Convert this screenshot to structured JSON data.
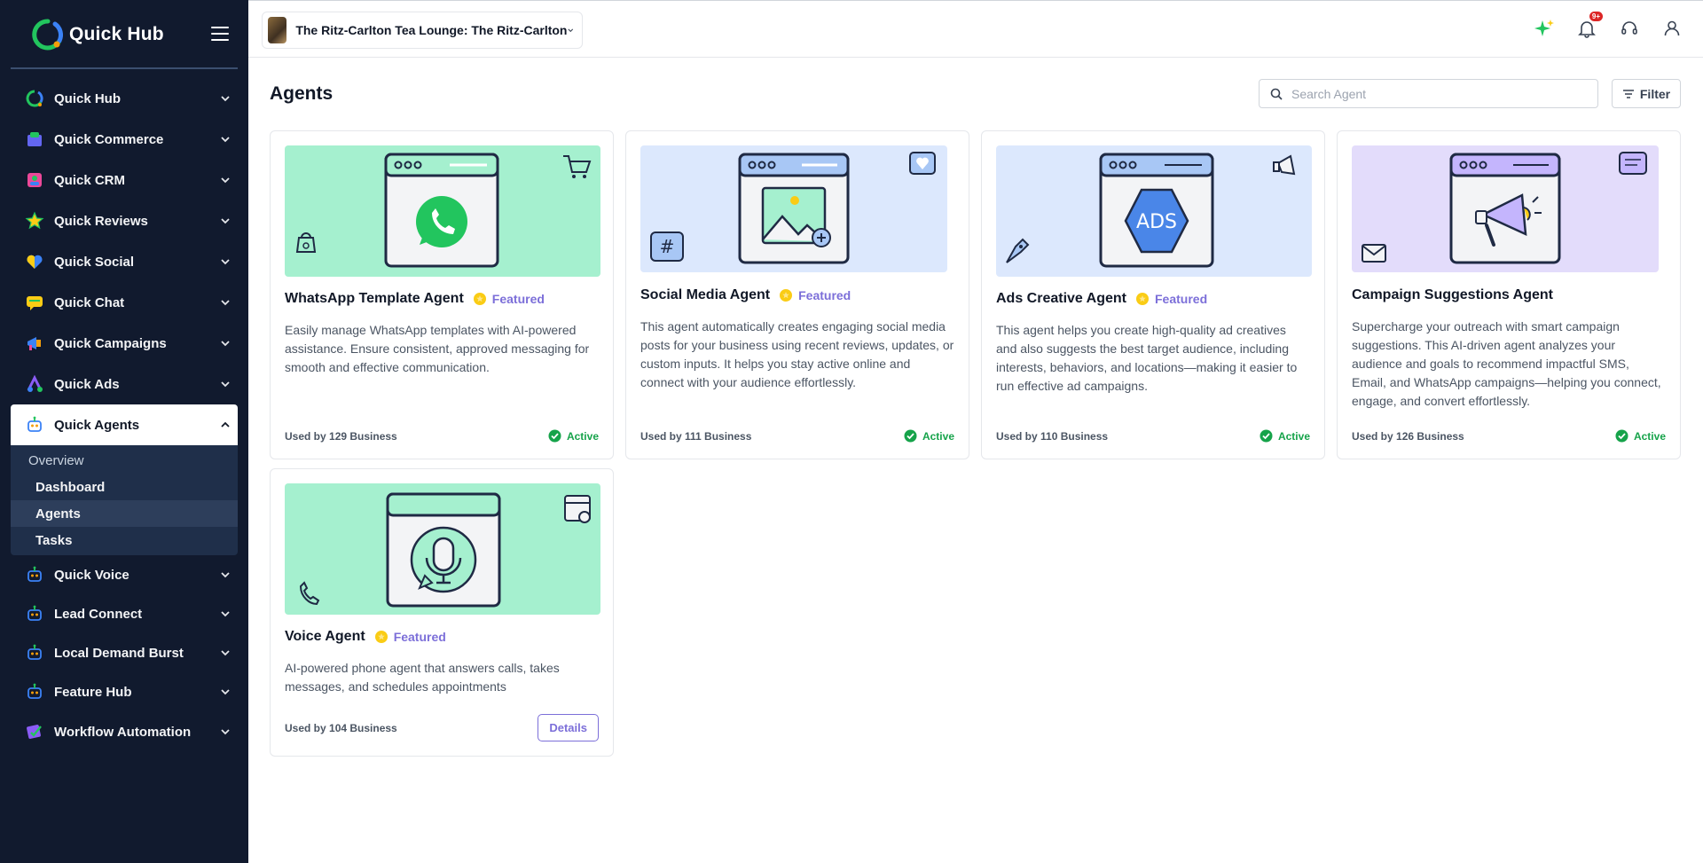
{
  "brand": {
    "name": "Quick Hub"
  },
  "sidebar": {
    "items": [
      {
        "label": "Quick Hub",
        "icon": "quick-hub-icon"
      },
      {
        "label": "Quick Commerce",
        "icon": "commerce-icon"
      },
      {
        "label": "Quick CRM",
        "icon": "crm-icon"
      },
      {
        "label": "Quick Reviews",
        "icon": "reviews-star-icon"
      },
      {
        "label": "Quick Social",
        "icon": "social-heart-icon"
      },
      {
        "label": "Quick Chat",
        "icon": "chat-icon"
      },
      {
        "label": "Quick Campaigns",
        "icon": "megaphone-icon"
      },
      {
        "label": "Quick Ads",
        "icon": "ads-icon"
      },
      {
        "label": "Quick Agents",
        "icon": "robot-icon"
      },
      {
        "label": "Quick Voice",
        "icon": "robot-icon"
      },
      {
        "label": "Lead Connect",
        "icon": "robot-icon"
      },
      {
        "label": "Local Demand Burst",
        "icon": "robot-icon"
      },
      {
        "label": "Feature Hub",
        "icon": "robot-icon"
      },
      {
        "label": "Workflow Automation",
        "icon": "workflow-icon"
      }
    ],
    "submenu": {
      "overview": "Overview",
      "items": [
        "Dashboard",
        "Agents",
        "Tasks"
      ]
    }
  },
  "topbar": {
    "location": "The Ritz-Carlton Tea Lounge: The Ritz-Carlton",
    "notification_badge": "9+"
  },
  "main": {
    "title": "Agents",
    "search_placeholder": "Search Agent",
    "filter_label": "Filter"
  },
  "agents": [
    {
      "title": "WhatsApp Template Agent",
      "featured": "Featured",
      "description": "Easily manage WhatsApp templates with AI-powered assistance. Ensure consistent, approved messaging for smooth and effective communication.",
      "used": "Used by 129 Business",
      "status": "Active",
      "bg": "#a5f0cf"
    },
    {
      "title": "Social Media Agent",
      "featured": "Featured",
      "description": "This agent automatically creates engaging social media posts for your business using recent reviews, updates, or custom inputs. It helps you stay active online and connect with your audience effortlessly.",
      "used": "Used by 111 Business",
      "status": "Active",
      "bg": "#dce8fd"
    },
    {
      "title": "Ads Creative Agent",
      "featured": "Featured",
      "description": "This agent helps you create high-quality ad creatives and also suggests the best target audience, including interests, behaviors, and locations—making it easier to run effective ad campaigns.",
      "used": "Used by 110 Business",
      "status": "Active",
      "bg": "#dce8fd"
    },
    {
      "title": "Campaign Suggestions Agent",
      "featured": "",
      "description": "Supercharge your outreach with smart campaign suggestions. This AI-driven agent analyzes your audience and goals to recommend impactful SMS, Email, and WhatsApp campaigns—helping you connect, engage, and convert effortlessly.",
      "used": "Used by 126 Business",
      "status": "Active",
      "bg": "#e3dcfb"
    },
    {
      "title": "Voice Agent",
      "featured": "Featured",
      "description": "AI-powered phone agent that answers calls, takes messages, and schedules appointments",
      "used": "Used by 104 Business",
      "action": "Details",
      "bg": "#a5f0cf"
    }
  ]
}
